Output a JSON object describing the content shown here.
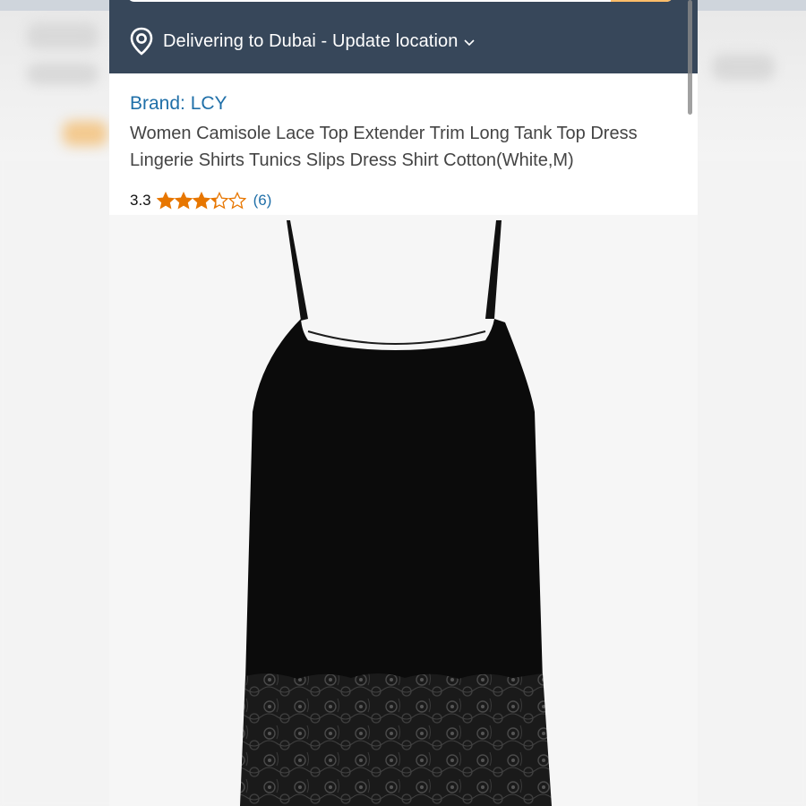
{
  "delivery": {
    "label": "Delivering to Dubai - Update location",
    "icon": "location-pin-icon"
  },
  "product": {
    "brand_label": "Brand: LCY",
    "title": "Women Camisole Lace Top Extender Trim Long Tank Top Dress Lingerie Shirts Tunics Slips Dress Shirt Cotton(White,M)",
    "rating_value": "3.3",
    "rating_stars": 3.3,
    "rating_max": 5,
    "review_count": "(6)",
    "image": "black-lace-camisole-image"
  },
  "colors": {
    "header": "#37475a",
    "link": "#1f6fa8",
    "star": "#e77600",
    "search_button": "#febd69"
  }
}
